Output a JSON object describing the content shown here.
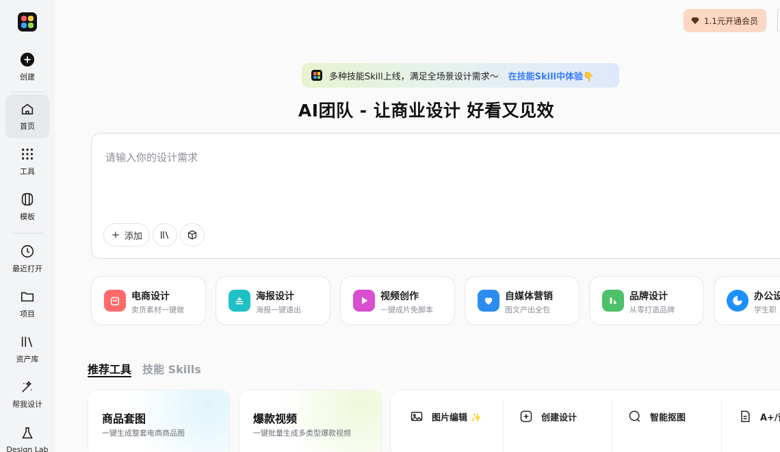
{
  "sidebar": {
    "items": [
      {
        "label": "创建",
        "icon": "plus-circle-icon"
      },
      {
        "label": "首页",
        "icon": "home-icon"
      },
      {
        "label": "工具",
        "icon": "grid-dots-icon"
      },
      {
        "label": "模板",
        "icon": "template-icon"
      },
      {
        "label": "最近打开",
        "icon": "clock-icon"
      },
      {
        "label": "项目",
        "icon": "folder-icon"
      },
      {
        "label": "资产库",
        "icon": "library-icon"
      },
      {
        "label": "帮我设计",
        "icon": "magic-wand-icon"
      },
      {
        "label": "Design Lab",
        "icon": "flask-icon"
      }
    ]
  },
  "header": {
    "vip_label": "1.1元开通会员"
  },
  "banner": {
    "text": "多种技能Skill上线，满足全场景设计需求〜",
    "link": "在技能Skill中体验👇"
  },
  "headline": "AI团队 - 让商业设计 好看又见效",
  "input": {
    "placeholder": "请输入你的设计需求",
    "add_label": "添加"
  },
  "categories": [
    {
      "title": "电商设计",
      "sub": "卖货素材一键做",
      "color": "#ff6b6b"
    },
    {
      "title": "海报设计",
      "sub": "海报一键速出",
      "color": "#1fc0c6"
    },
    {
      "title": "视频创作",
      "sub": "一键成片免脚本",
      "color": "#d94fd0"
    },
    {
      "title": "自媒体营销",
      "sub": "图文产出全包",
      "color": "#2d8cf0"
    },
    {
      "title": "品牌设计",
      "sub": "从零打造品牌",
      "color": "#4cc06a"
    },
    {
      "title": "办公设",
      "sub": "学生职",
      "color": "#1e90ff"
    }
  ],
  "tabs": {
    "recommend": "推荐工具",
    "skills": "技能 Skills"
  },
  "tool_cards": [
    {
      "title": "商品套图",
      "sub": "一键生成整套电商商品图"
    },
    {
      "title": "爆款视频",
      "sub": "一键批量生成多类型爆款视频"
    }
  ],
  "tools": [
    {
      "label": "图片编辑 ✨",
      "icon": "image-edit-icon"
    },
    {
      "label": "创建设计",
      "icon": "plus-square-icon"
    },
    {
      "label": "智能抠图",
      "icon": "cutout-icon"
    },
    {
      "label": "A+/详",
      "icon": "document-icon"
    }
  ]
}
